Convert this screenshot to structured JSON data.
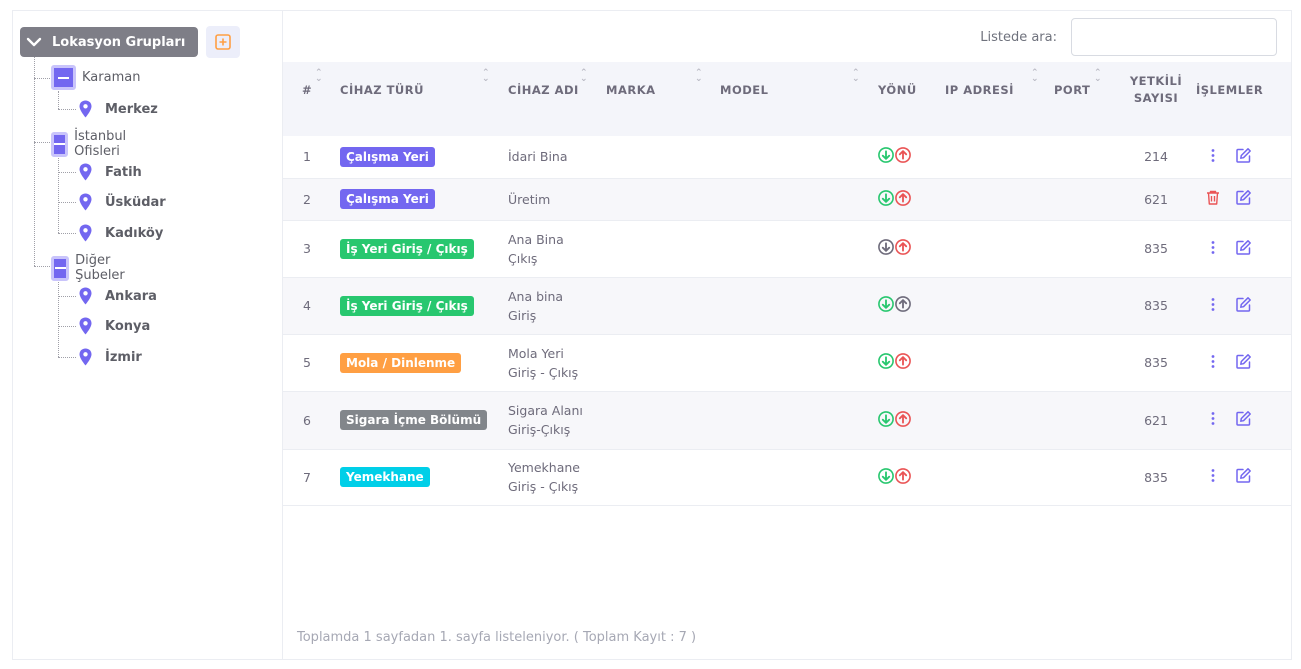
{
  "sidebar": {
    "root_label": "Lokasyon Grupları",
    "groups": [
      {
        "label": "Karaman",
        "items": [
          "Merkez"
        ]
      },
      {
        "label": "İstanbul Ofisleri",
        "items": [
          "Fatih",
          "Üsküdar",
          "Kadıköy"
        ]
      },
      {
        "label": "Diğer Şubeler",
        "items": [
          "Ankara",
          "Konya",
          "İzmir"
        ]
      }
    ]
  },
  "search": {
    "label": "Listede ara:",
    "placeholder": "",
    "value": ""
  },
  "table": {
    "headers": {
      "num": "#",
      "type": "CİHAZ TÜRÜ",
      "name": "CİHAZ ADI",
      "brand": "MARKA",
      "model": "MODEL",
      "direction": "YÖNÜ",
      "ip": "IP ADRESİ",
      "port": "PORT",
      "auth_1": "YETKİLİ",
      "auth_2": "SAYISI",
      "actions": "İŞLEMLER"
    },
    "rows": [
      {
        "num": "1",
        "type": "Çalışma Yeri",
        "type_color": "#7367f0",
        "name_1": "İdari Bina",
        "name_2": "",
        "in_active": true,
        "out_active": true,
        "count": "214",
        "action": "more"
      },
      {
        "num": "2",
        "type": "Çalışma Yeri",
        "type_color": "#7367f0",
        "name_1": "Üretim",
        "name_2": "",
        "in_active": true,
        "out_active": true,
        "count": "621",
        "action": "delete"
      },
      {
        "num": "3",
        "type": "İş Yeri Giriş / Çıkış",
        "type_color": "#28c76f",
        "name_1": "Ana Bina",
        "name_2": "Çıkış",
        "in_active": false,
        "out_active": true,
        "count": "835",
        "action": "more"
      },
      {
        "num": "4",
        "type": "İş Yeri Giriş / Çıkış",
        "type_color": "#28c76f",
        "name_1": "Ana bina",
        "name_2": "Giriş",
        "in_active": true,
        "out_active": false,
        "count": "835",
        "action": "more"
      },
      {
        "num": "5",
        "type": "Mola / Dinlenme",
        "type_color": "#ff9f43",
        "name_1": "Mola Yeri",
        "name_2": "Giriş - Çıkış",
        "in_active": true,
        "out_active": true,
        "count": "835",
        "action": "more"
      },
      {
        "num": "6",
        "type": "Sigara İçme Bölümü",
        "type_color": "#82868b",
        "name_1": "Sigara Alanı",
        "name_2": "Giriş-Çıkış",
        "in_active": true,
        "out_active": true,
        "count": "621",
        "action": "more"
      },
      {
        "num": "7",
        "type": "Yemekhane",
        "type_color": "#00cfe8",
        "name_1": "Yemekhane",
        "name_2": "Giriş - Çıkış",
        "in_active": true,
        "out_active": true,
        "count": "835",
        "action": "more"
      }
    ]
  },
  "footer": {
    "text": "Toplamda 1 sayfadan 1. sayfa listeleniyor. ( Toplam Kayıt : 7 )"
  },
  "colors": {
    "accent": "#7367f0",
    "in": "#28c76f",
    "out": "#ea5455",
    "inactive": "#6e6b7b",
    "add": "#ff9f43"
  }
}
